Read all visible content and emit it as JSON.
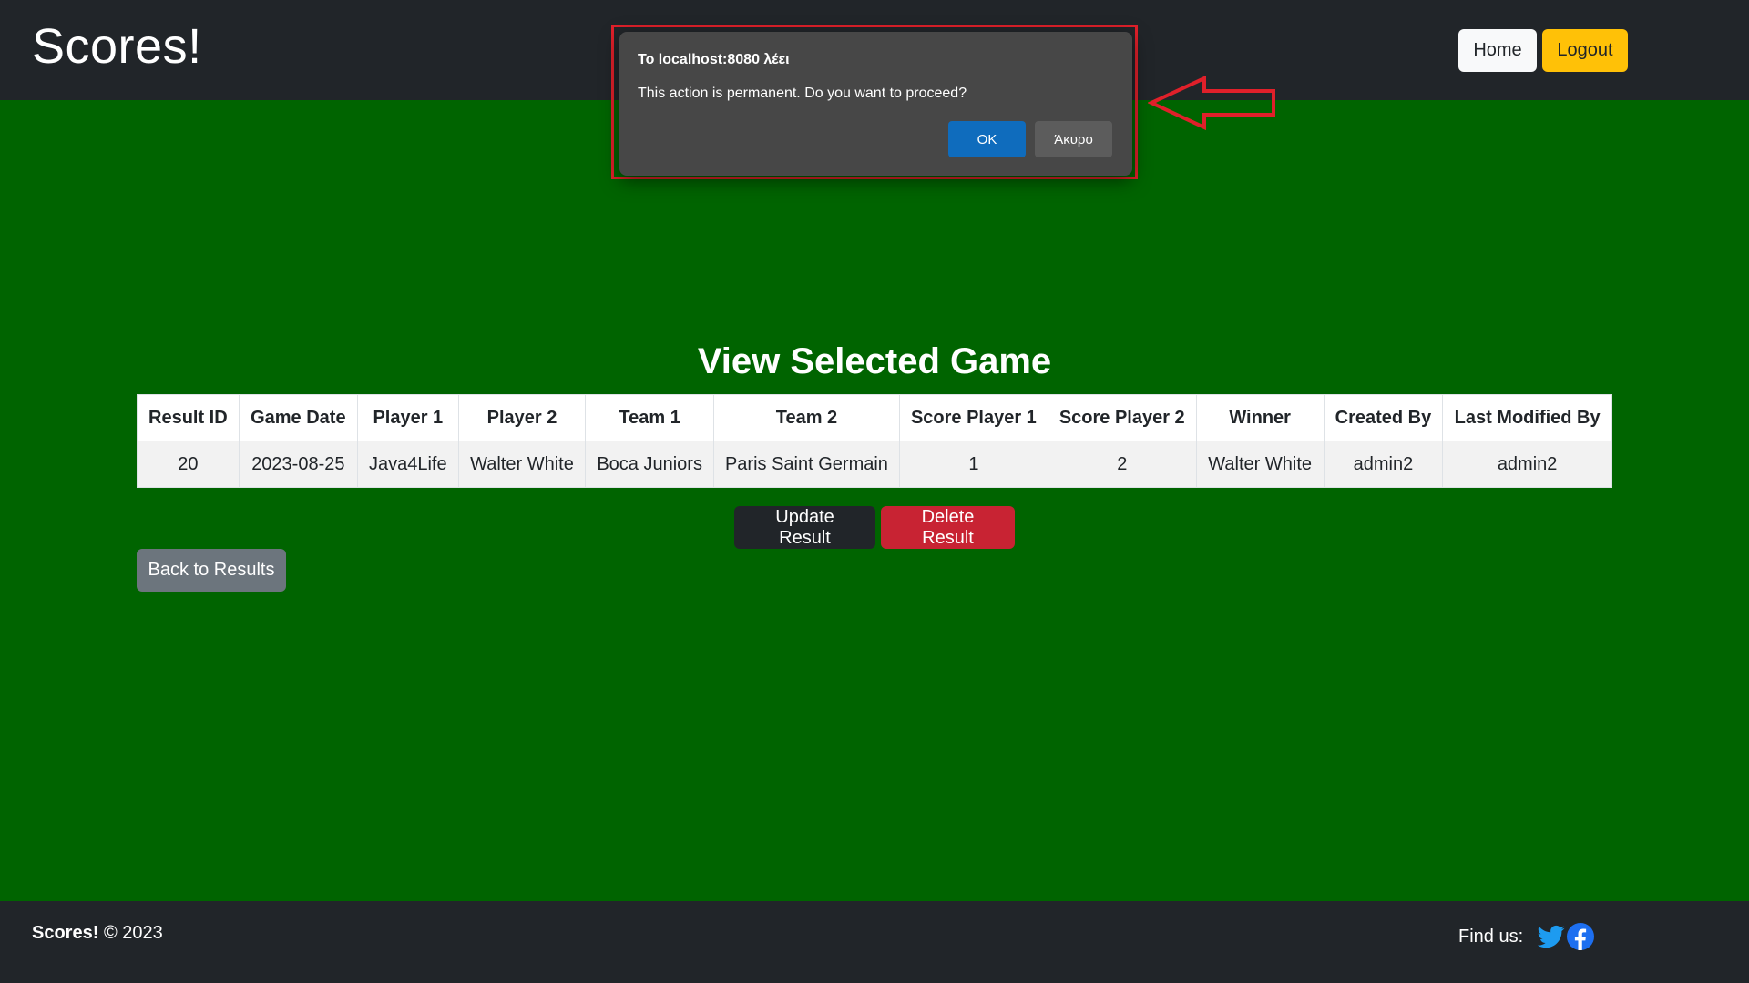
{
  "header": {
    "brand": "Scores!",
    "home_label": "Home",
    "logout_label": "Logout"
  },
  "main": {
    "title": "View Selected Game",
    "table": {
      "columns": [
        "Result ID",
        "Game Date",
        "Player 1",
        "Player 2",
        "Team 1",
        "Team 2",
        "Score Player 1",
        "Score Player 2",
        "Winner",
        "Created By",
        "Last Modified By"
      ],
      "rows": [
        [
          "20",
          "2023-08-25",
          "Java4Life",
          "Walter White",
          "Boca Juniors",
          "Paris Saint Germain",
          "1",
          "2",
          "Walter White",
          "admin2",
          "admin2"
        ]
      ]
    },
    "update_label": "Update Result",
    "delete_label": "Delete Result",
    "back_label": "Back to Results"
  },
  "footer": {
    "brand": "Scores!",
    "copyright": "© 2023",
    "find_us": "Find us:",
    "icons": [
      "twitter-icon",
      "facebook-icon"
    ]
  },
  "dialog": {
    "title": "To localhost:8080 λέει",
    "message": "This action is permanent. Do you want to proceed?",
    "ok_label": "OK",
    "cancel_label": "Άκυρο"
  },
  "colors": {
    "background": "#006400",
    "header": "#212529",
    "logout": "#ffc107",
    "delete": "#c82333",
    "back": "#6c757d",
    "dialog_ok": "#0f6cbd",
    "highlight": "#e0202a",
    "social": "#1d9bf0"
  }
}
